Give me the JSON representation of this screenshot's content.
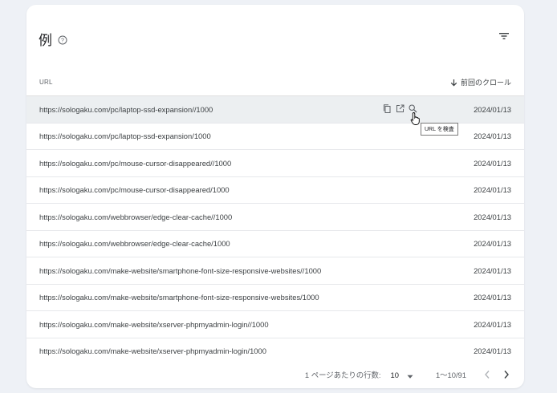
{
  "title": "例",
  "table": {
    "col_url": "URL",
    "col_date": "前回のクロール",
    "rows": [
      {
        "url": "https://sologaku.com/pc/laptop-ssd-expansion//1000",
        "date": "2024/01/13"
      },
      {
        "url": "https://sologaku.com/pc/laptop-ssd-expansion/1000",
        "date": "2024/01/13"
      },
      {
        "url": "https://sologaku.com/pc/mouse-cursor-disappeared//1000",
        "date": "2024/01/13"
      },
      {
        "url": "https://sologaku.com/pc/mouse-cursor-disappeared/1000",
        "date": "2024/01/13"
      },
      {
        "url": "https://sologaku.com/webbrowser/edge-clear-cache//1000",
        "date": "2024/01/13"
      },
      {
        "url": "https://sologaku.com/webbrowser/edge-clear-cache/1000",
        "date": "2024/01/13"
      },
      {
        "url": "https://sologaku.com/make-website/smartphone-font-size-responsive-websites//1000",
        "date": "2024/01/13"
      },
      {
        "url": "https://sologaku.com/make-website/smartphone-font-size-responsive-websites/1000",
        "date": "2024/01/13"
      },
      {
        "url": "https://sologaku.com/make-website/xserver-phpmyadmin-login//1000",
        "date": "2024/01/13"
      },
      {
        "url": "https://sologaku.com/make-website/xserver-phpmyadmin-login/1000",
        "date": "2024/01/13"
      }
    ]
  },
  "tooltip": "URL を検査",
  "footer": {
    "rows_per_page_label": "1 ページあたりの行数:",
    "rows_per_page_value": "10",
    "range": "1〜10/91"
  },
  "icons": {
    "help": "help-circle-icon",
    "filter": "filter-icon",
    "sort": "arrow-down-icon",
    "copy": "copy-icon",
    "open": "open-in-new-icon",
    "inspect": "search-icon",
    "cursor": "hand-pointer-icon"
  },
  "colors": {
    "background": "#eef1f6",
    "card": "#ffffff",
    "row_hover": "#eceff1"
  }
}
